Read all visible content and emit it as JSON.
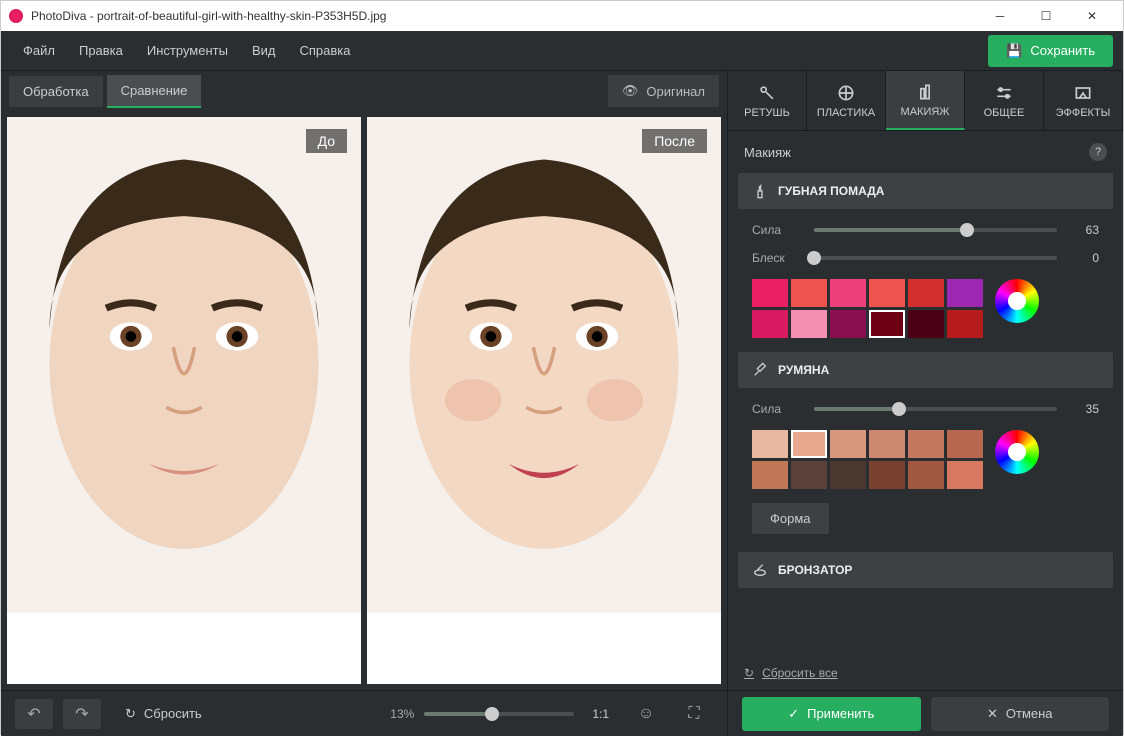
{
  "window": {
    "title": "PhotoDiva - portrait-of-beautiful-girl-with-healthy-skin-P353H5D.jpg"
  },
  "menu": {
    "file": "Файл",
    "edit": "Правка",
    "tools": "Инструменты",
    "view": "Вид",
    "help": "Справка",
    "save": "Сохранить"
  },
  "viewTabs": {
    "processing": "Обработка",
    "compare": "Сравнение",
    "original": "Оригинал"
  },
  "labels": {
    "before": "До",
    "after": "После"
  },
  "bottom": {
    "reset": "Сбросить",
    "zoom": "13%",
    "ratio": "1:1"
  },
  "toolTabs": {
    "retouch": "РЕТУШЬ",
    "sculpt": "ПЛАСТИКА",
    "makeup": "МАКИЯЖ",
    "general": "ОБЩЕЕ",
    "effects": "ЭФФЕКТЫ"
  },
  "panel": {
    "title": "Макияж",
    "resetAll": "Сбросить все",
    "apply": "Применить",
    "cancel": "Отмена"
  },
  "lipstick": {
    "title": "ГУБНАЯ ПОМАДА",
    "strength_label": "Сила",
    "strength_value": "63",
    "gloss_label": "Блеск",
    "gloss_value": "0",
    "colors_row1": [
      "#e91e63",
      "#ef5350",
      "#ec407a",
      "#ef5350",
      "#d32f2f",
      "#9c27b0"
    ],
    "colors_row2": [
      "#d81b60",
      "#f48fb1",
      "#880e4f",
      "#6d0015",
      "#4a0015",
      "#b71c1c"
    ],
    "selected_index": 9
  },
  "blush": {
    "title": "РУМЯНА",
    "strength_label": "Сила",
    "strength_value": "35",
    "colors_row1": [
      "#e8b8a0",
      "#e8a890",
      "#d89880",
      "#cc8870",
      "#c47860",
      "#b86850"
    ],
    "colors_row2": [
      "#c07858",
      "#5a4038",
      "#4a3830",
      "#7a4030",
      "#a05840",
      "#d87860"
    ],
    "selected_index": 1,
    "shape": "Форма"
  },
  "bronzer": {
    "title": "БРОНЗАТОР"
  }
}
